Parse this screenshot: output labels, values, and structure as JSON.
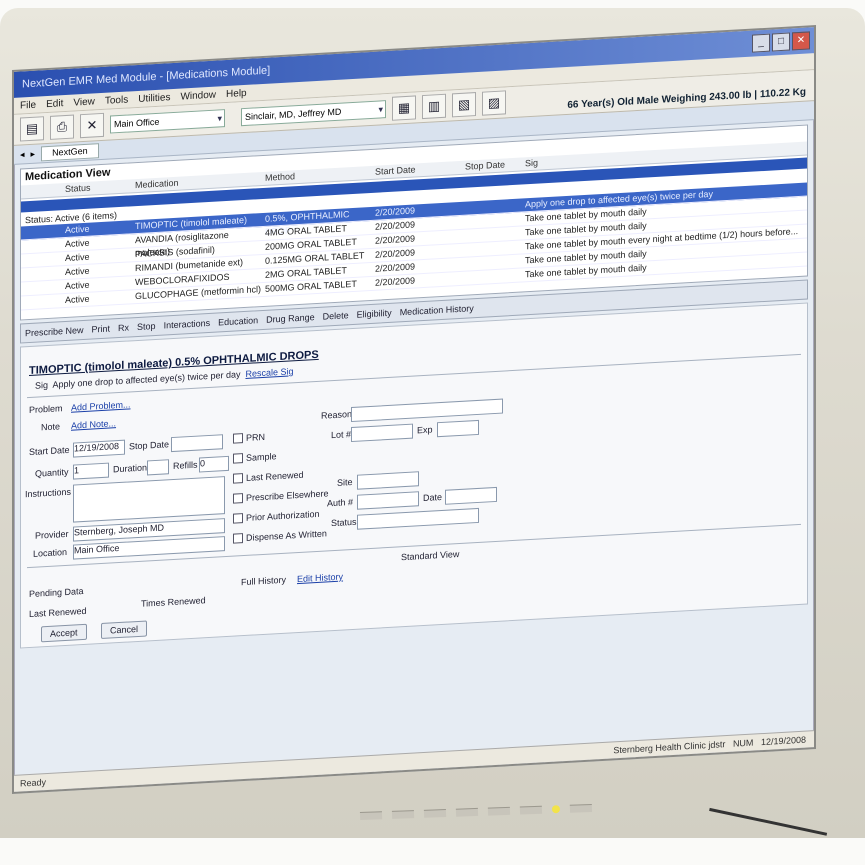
{
  "window": {
    "title": "NextGen EMR Med Module - [Medications Module]"
  },
  "menu": [
    "File",
    "Edit",
    "View",
    "Tools",
    "Utilities",
    "Window",
    "Help"
  ],
  "toolbar": {
    "location": "Main Office",
    "provider": "Sinclair, MD, Jeffrey  MD",
    "patient": "66 Year(s) Old Male Weighing 243.00 lb | 110.22 Kg"
  },
  "nav": {
    "tab": "NextGen"
  },
  "medview": {
    "title": "Medication View",
    "columns": [
      "Status",
      "Medication",
      "Method",
      "Start Date",
      "Stop Date",
      "Sig"
    ],
    "group": "Status: Active (6 items)",
    "rows": [
      {
        "status": "Active",
        "med": "TIMOPTIC (timolol maleate)",
        "method": "0.5%, OPHTHALMIC DROP",
        "start": "2/20/2009",
        "sig": "Apply one drop to affected eye(s) twice per day"
      },
      {
        "status": "Active",
        "med": "AVANDIA (rosiglitazone maleate)",
        "method": "4MG ORAL TABLET",
        "start": "2/20/2009",
        "sig": "Take one tablet by mouth daily"
      },
      {
        "status": "Active",
        "med": "PACKSIS (sodafinil)",
        "method": "200MG ORAL TABLET",
        "start": "2/20/2009",
        "sig": "Take one tablet by mouth daily"
      },
      {
        "status": "Active",
        "med": "RIMANDI (bumetanide ext)",
        "method": "0.125MG ORAL TABLET",
        "start": "2/20/2009",
        "sig": "Take one tablet by mouth every night at bedtime (1/2) hours before..."
      },
      {
        "status": "Active",
        "med": "WEBOCLORAFIXIDOS",
        "method": "2MG ORAL TABLET",
        "start": "2/20/2009",
        "sig": "Take one tablet by mouth daily"
      },
      {
        "status": "Active",
        "med": "GLUCOPHAGE (metformin hcl)",
        "method": "500MG ORAL TABLET",
        "start": "2/20/2009",
        "sig": "Take one tablet by mouth daily"
      }
    ]
  },
  "actions": [
    "Prescribe New",
    "Print",
    "Rx",
    "Stop",
    "Interactions",
    "Education",
    "Drug Range",
    "Delete",
    "Eligibility",
    "Medication History"
  ],
  "form": {
    "drug": "TIMOPTIC (timolol maleate) 0.5% OPHTHALMIC DROPS",
    "sig_label": "Sig",
    "sig": "Apply one drop to affected eye(s) twice per day",
    "sig_link": "Rescale Sig",
    "problem_label": "Problem",
    "problem_link": "Add Problem...",
    "note_label": "Note",
    "note_link": "Add Note...",
    "start_label": "Start Date",
    "start_value": "12/19/2008",
    "stop_label": "Stop Date",
    "quantity_label": "Quantity",
    "quantity_value": "1",
    "duration_label": "Duration",
    "refills_label": "Refills",
    "refills_value": "0",
    "instructions_label": "Instructions",
    "provider_label": "Provider",
    "provider_value": "Sternberg, Joseph MD",
    "location_label": "Location",
    "location_value": "Main Office",
    "checks": [
      "PRN",
      "Sample",
      "Last Renewed",
      "Prescribe Elsewhere",
      "Prior Authorization",
      "Dispense As Written"
    ],
    "reason_label": "Reason",
    "lot_label": "Lot #",
    "exp_label": "Exp",
    "site_label": "Site",
    "auth_label": "Auth #",
    "date_label": "Date",
    "status_label": "Status",
    "pending_label": "Pending Data",
    "last_renewed_label": "Last Renewed",
    "times_renewed_label": "Times Renewed",
    "full_history": "Full History",
    "edit_history": "Edit History",
    "standard_view": "Standard View",
    "accept": "Accept",
    "cancel": "Cancel"
  },
  "status": {
    "left": "Ready",
    "center": "Sternberg Health Clinic  jdstr",
    "right": "NUM",
    "date": "12/19/2008"
  }
}
